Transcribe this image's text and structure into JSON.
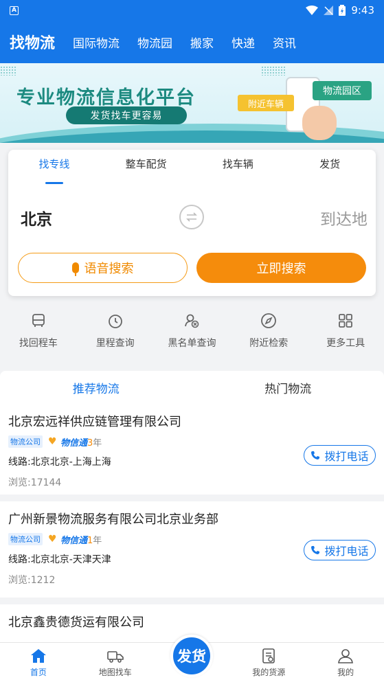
{
  "status": {
    "time": "9:43"
  },
  "nav": {
    "brand": "找物流",
    "items": [
      "国际物流",
      "物流园",
      "搬家",
      "快递",
      "资讯"
    ]
  },
  "banner": {
    "title": "专业物流信息化平台",
    "subtitle": "发货找车更容易",
    "tag_nearby": "附近车辆",
    "tag_park": "物流园区"
  },
  "search": {
    "tabs": [
      "找专线",
      "整车配货",
      "找车辆",
      "发货"
    ],
    "active_tab": 0,
    "from": "北京",
    "to": "到达地",
    "voice_label": "语音搜索",
    "search_label": "立即搜索"
  },
  "tools": [
    {
      "label": "找回程车",
      "icon": "bus-icon"
    },
    {
      "label": "里程查询",
      "icon": "timer-icon"
    },
    {
      "label": "黑名单查询",
      "icon": "user-block-icon"
    },
    {
      "label": "附近检索",
      "icon": "compass-icon"
    },
    {
      "label": "更多工具",
      "icon": "grid-icon"
    }
  ],
  "list": {
    "segments": [
      "推荐物流",
      "热门物流"
    ],
    "active_segment": 0,
    "call_label": "拨打电话",
    "xin_label": "物信通",
    "items": [
      {
        "name": "北京宏远祥供应链管理有限公司",
        "type": "物流公司",
        "years": "3",
        "years_unit": "年",
        "route": "线路:北京北京-上海上海",
        "views": "浏览:17144"
      },
      {
        "name": "广州新景物流服务有限公司北京业务部",
        "type": "物流公司",
        "years": "1",
        "years_unit": "年",
        "route": "线路:北京北京-天津天津",
        "views": "浏览:1212"
      },
      {
        "name": "北京鑫贵德货运有限公司"
      }
    ]
  },
  "bottom": {
    "items": [
      {
        "label": "首页",
        "icon": "home-icon"
      },
      {
        "label": "地图找车",
        "icon": "truck-icon"
      },
      {
        "label": "我的货源",
        "icon": "cargo-icon"
      },
      {
        "label": "我的",
        "icon": "user-icon"
      }
    ],
    "fab_label": "发货"
  },
  "colors": {
    "primary": "#1677e8",
    "accent": "#f58c0c"
  }
}
